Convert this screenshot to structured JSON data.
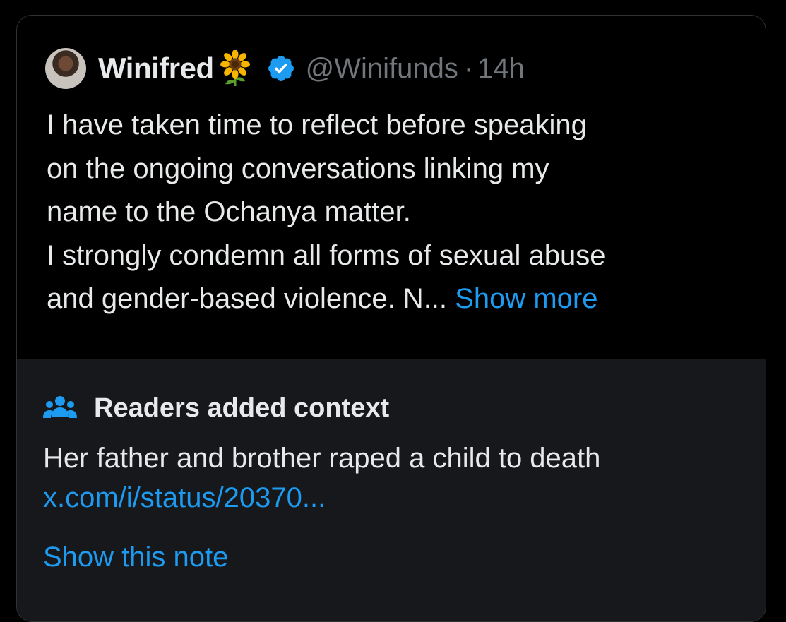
{
  "post": {
    "author": {
      "display_name": "Winifred",
      "emoji": "sunflower",
      "verified": true,
      "handle": "@Winifunds",
      "separator": "·",
      "time": "14h"
    },
    "text_lines": [
      "I have taken time to reflect before speaking",
      "on the ongoing conversations linking my",
      "name to the Ochanya matter.",
      "I strongly condemn all forms of sexual abuse",
      "and gender-based violence. N... "
    ],
    "show_more_label": "Show more"
  },
  "community_note": {
    "icon": "people-icon",
    "title": "Readers added context",
    "body": "Her father and brother raped a child to death",
    "link": "x.com/i/status/20370...",
    "show_note_label": "Show this note"
  },
  "colors": {
    "background": "#000000",
    "text": "#e7e9ea",
    "secondary": "#71767b",
    "accent": "#1d9bf0",
    "note_background": "#16181c",
    "border": "#2f3336"
  }
}
